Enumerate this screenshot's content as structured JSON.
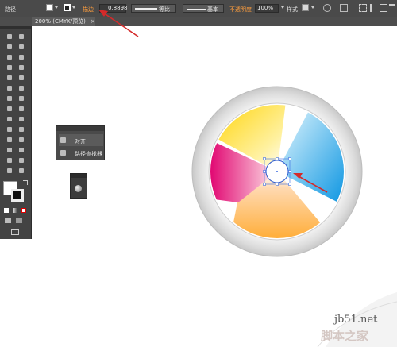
{
  "control_bar": {
    "object_type": "路径",
    "stroke_label": "描边",
    "stroke_weight": "0.8898",
    "stroke_profile": "等比",
    "brush": "基本",
    "opacity_label": "不透明度",
    "opacity_value": "100%",
    "style_label": "样式"
  },
  "document_tab": {
    "title": "200% (CMYK/预览)",
    "close_glyph": "×"
  },
  "floating_panel": {
    "items": [
      {
        "label": "对齐",
        "icon": "align-icon"
      },
      {
        "label": "路径查找器",
        "icon": "pathfinder-icon"
      }
    ]
  },
  "watermark": {
    "site": "jb51.net",
    "brand": "脚本之家"
  },
  "colors": {
    "annotation_arrow": "#d42a2a",
    "ui_dark": "#434343",
    "accent_orange": "#ff9e3d"
  },
  "artwork": {
    "description_icons": [
      "color-wheel",
      "selected-center-circle"
    ]
  }
}
